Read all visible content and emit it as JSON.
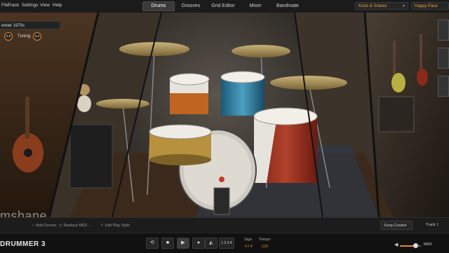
{
  "menu": {
    "items": [
      "File",
      "Track",
      "Settings",
      "View",
      "Help"
    ]
  },
  "tabs": [
    {
      "label": "Drums",
      "active": true
    },
    {
      "label": "Grooves",
      "active": false
    },
    {
      "label": "Grid Editor",
      "active": false
    },
    {
      "label": "Mixer",
      "active": false
    },
    {
      "label": "Bandmate",
      "active": false
    }
  ],
  "presets": {
    "preset_value": "Kicks & Snares",
    "groove_value": "Happy Pace"
  },
  "kit": {
    "name": "emier 1970s",
    "knob1_value": "0.0",
    "tuning_label": "Tuning",
    "tuning_value": "0.0"
  },
  "toolbar": {
    "add_groove": "Add Groove",
    "replace_midi": "Replace MIDI...",
    "edit_play_style": "Edit Play Style",
    "song_creator": "Song Creator",
    "track": "Track 1"
  },
  "watermark": "mshane",
  "transport": {
    "logo": "DRUMMER 3",
    "count_in": "1 2 3 4",
    "sign_label": "Sign.",
    "sign_value": "4 / 4",
    "tempo_label": "Tempo",
    "tempo_value": "120",
    "midi_label": "MIDI",
    "volume_level": 0.73
  },
  "icons": {
    "loop": "loop-icon",
    "stop": "stop-icon",
    "play": "play-icon",
    "record": "record-icon",
    "metronome": "metronome-icon",
    "speaker": "speaker-icon"
  },
  "colors": {
    "accent": "#e08a2c",
    "bar": "#1b1b1b"
  }
}
